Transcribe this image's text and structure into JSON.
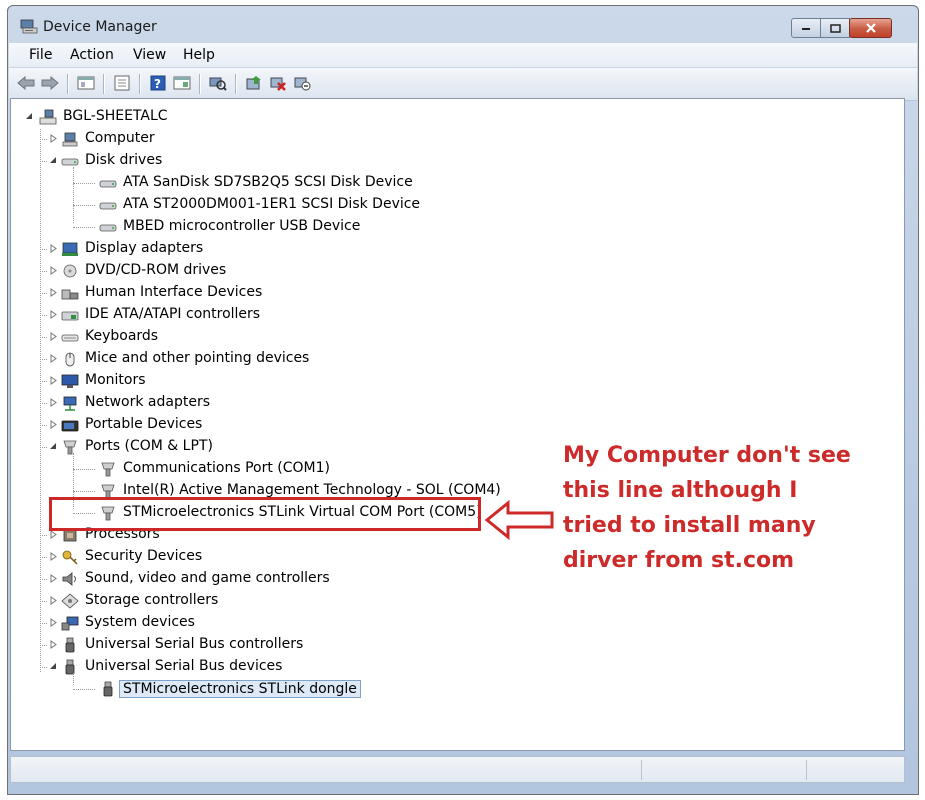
{
  "window": {
    "title": "Device Manager",
    "colors": {
      "frame": "#b9cbe2",
      "close_button": "#c75b43",
      "annotation_red": "#cd2a2a"
    }
  },
  "menu": [
    "File",
    "Action",
    "View",
    "Help"
  ],
  "toolbar_icons": [
    "back-arrow-icon",
    "forward-arrow-icon",
    "show-hide-console-tree-icon",
    "properties-icon",
    "help-icon",
    "show-hide-action-pane-icon",
    "scan-hardware-changes-icon",
    "update-driver-icon",
    "uninstall-icon",
    "disable-icon"
  ],
  "tree": {
    "root": "BGL-SHEETALC",
    "nodes": [
      {
        "label": "Computer",
        "icon": "computer-icon",
        "expanded": false
      },
      {
        "label": "Disk drives",
        "icon": "disk-drive-icon",
        "expanded": true,
        "children": [
          "ATA SanDisk SD7SB2Q5 SCSI Disk Device",
          "ATA ST2000DM001-1ER1 SCSI Disk Device",
          "MBED microcontroller USB Device"
        ]
      },
      {
        "label": "Display adapters",
        "icon": "display-adapter-icon",
        "expanded": false
      },
      {
        "label": "DVD/CD-ROM drives",
        "icon": "dvd-drive-icon",
        "expanded": false
      },
      {
        "label": "Human Interface Devices",
        "icon": "hid-icon",
        "expanded": false
      },
      {
        "label": "IDE ATA/ATAPI controllers",
        "icon": "ide-controller-icon",
        "expanded": false
      },
      {
        "label": "Keyboards",
        "icon": "keyboard-icon",
        "expanded": false
      },
      {
        "label": "Mice and other pointing devices",
        "icon": "mouse-icon",
        "expanded": false
      },
      {
        "label": "Monitors",
        "icon": "monitor-icon",
        "expanded": false
      },
      {
        "label": "Network adapters",
        "icon": "network-adapter-icon",
        "expanded": false
      },
      {
        "label": "Portable Devices",
        "icon": "portable-device-icon",
        "expanded": false
      },
      {
        "label": "Ports (COM & LPT)",
        "icon": "port-icon",
        "expanded": true,
        "children": [
          "Communications Port (COM1)",
          "Intel(R) Active Management Technology - SOL (COM4)",
          "STMicroelectronics STLink Virtual COM Port (COM5)"
        ]
      },
      {
        "label": "Processors",
        "icon": "processor-icon",
        "expanded": false
      },
      {
        "label": "Security Devices",
        "icon": "security-key-icon",
        "expanded": false
      },
      {
        "label": "Sound, video and game controllers",
        "icon": "speaker-icon",
        "expanded": false
      },
      {
        "label": "Storage controllers",
        "icon": "storage-controller-icon",
        "expanded": false
      },
      {
        "label": "System devices",
        "icon": "system-device-icon",
        "expanded": false
      },
      {
        "label": "Universal Serial Bus controllers",
        "icon": "usb-icon",
        "expanded": false
      },
      {
        "label": "Universal Serial Bus devices",
        "icon": "usb-icon",
        "expanded": true,
        "children": [
          "STMicroelectronics STLink dongle"
        ]
      }
    ]
  },
  "annotation": {
    "lines": [
      "My Computer don't see",
      "this line although I",
      "tried to install many",
      "dirver from st.com"
    ]
  }
}
